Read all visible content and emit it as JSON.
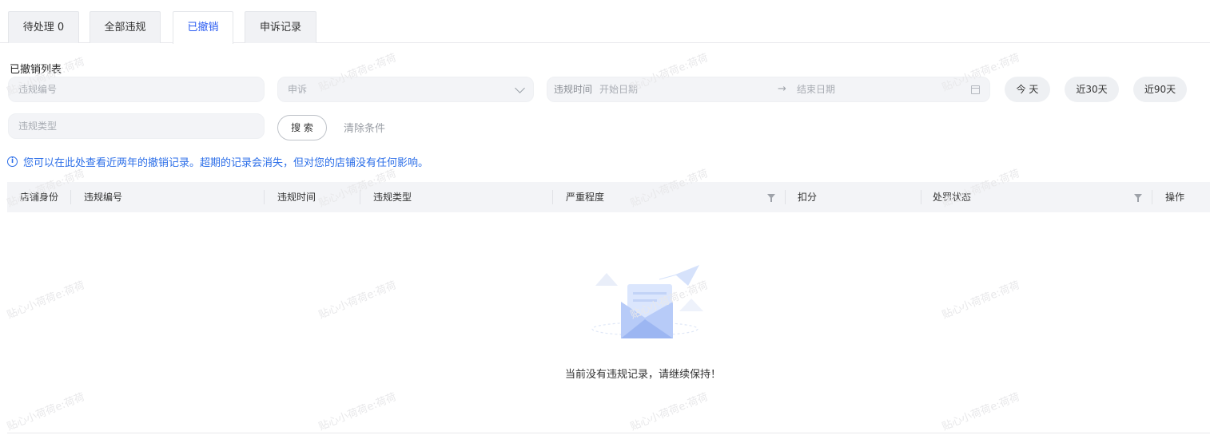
{
  "tabs": [
    {
      "label": "待处理 0",
      "active": false
    },
    {
      "label": "全部违规",
      "active": false
    },
    {
      "label": "已撤销",
      "active": true
    },
    {
      "label": "申诉记录",
      "active": false
    }
  ],
  "section_title": "已撤销列表",
  "filters": {
    "violation_id_placeholder": "违规编号",
    "appeal_placeholder": "申诉",
    "time_label": "违规时间",
    "start_date_placeholder": "开始日期",
    "end_date_placeholder": "结束日期",
    "violation_type_placeholder": "违规类型",
    "date_arrow": "→"
  },
  "quick_ranges": [
    "今 天",
    "近30天",
    "近90天"
  ],
  "actions": {
    "search": "搜 索",
    "clear": "清除条件"
  },
  "notice": {
    "icon": "i",
    "text": "您可以在此处查看近两年的撤销记录。超期的记录会消失，但对您的店铺没有任何影响。"
  },
  "table": {
    "columns": [
      "店铺身份",
      "违规编号",
      "违规时间",
      "违规类型",
      "严重程度",
      "扣分",
      "处罚状态",
      "操作"
    ]
  },
  "empty_state": {
    "message": "当前没有违规记录，请继续保持！"
  },
  "watermark": "贴心小荷荷e:荷荷",
  "colors": {
    "accent": "#2b5cf2",
    "notice": "#2b6ee8",
    "field_bg": "#f3f4f7"
  }
}
